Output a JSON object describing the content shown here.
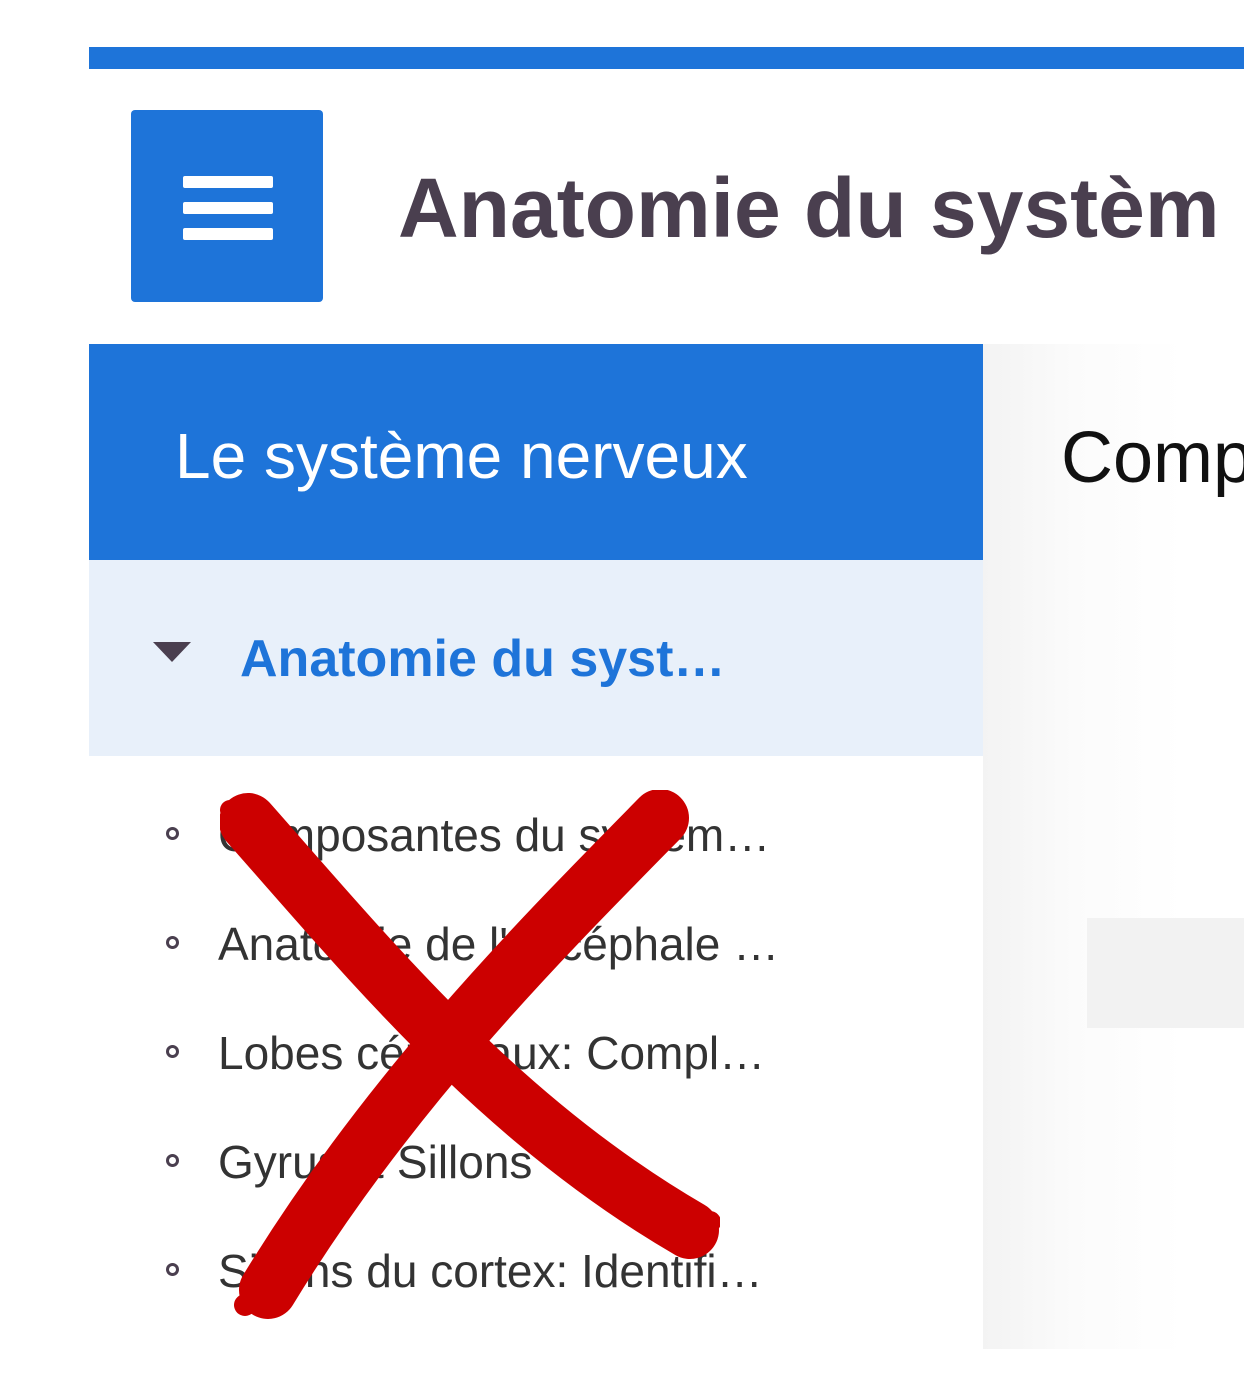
{
  "header": {
    "title": "Anatomie du systèm",
    "menu_icon": "hamburger-menu-icon",
    "accent_color": "#1e74d9"
  },
  "sidebar": {
    "course_title": "Le système nerveux",
    "section": {
      "label": "Anatomie du syst…",
      "expanded": true,
      "icon": "caret-down-icon"
    },
    "items": [
      {
        "label": "Composantes du systèm…"
      },
      {
        "label": "Anatomie de l'encéphale …"
      },
      {
        "label": "Lobes cérébraux: Compl…"
      },
      {
        "label": "Gyrus & Sillons"
      },
      {
        "label": "Sillons du cortex: Identifi…"
      }
    ]
  },
  "content": {
    "heading": "Comp"
  },
  "overlay": {
    "icon": "red-x-cross-icon",
    "color": "#cc0000"
  }
}
